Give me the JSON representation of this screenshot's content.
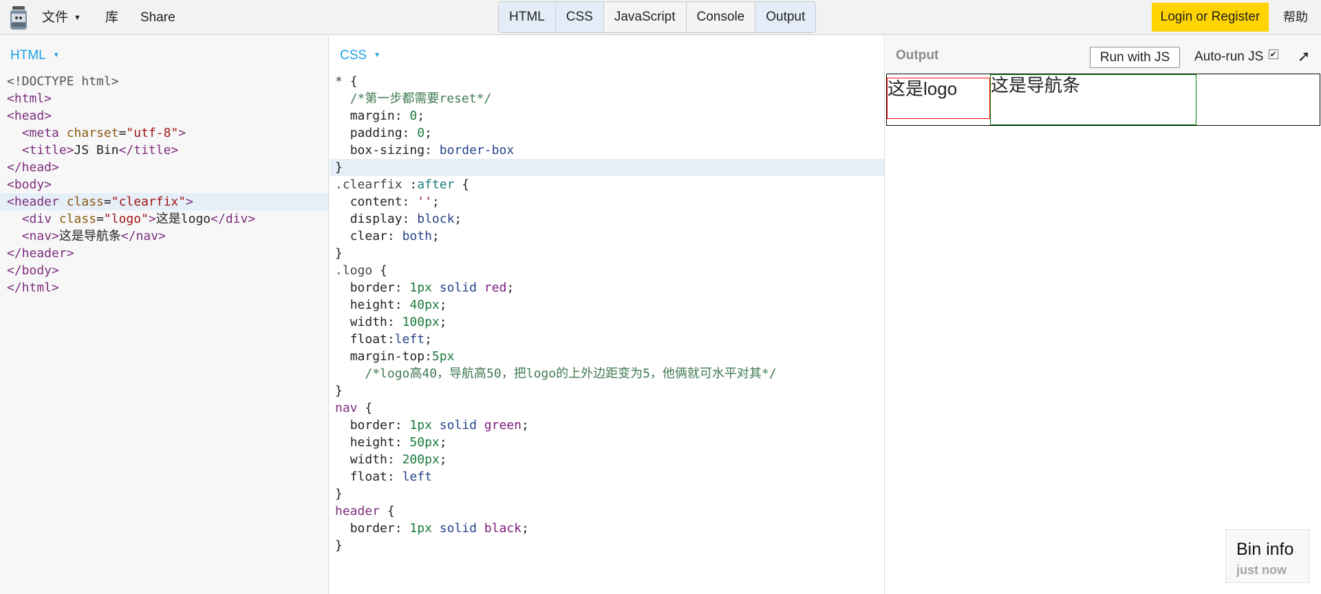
{
  "toolbar": {
    "menu_file": "文件",
    "menu_library": "库",
    "menu_share": "Share",
    "tabs": [
      "HTML",
      "CSS",
      "JavaScript",
      "Console",
      "Output"
    ],
    "active_tabs": [
      "HTML",
      "CSS",
      "Output"
    ],
    "login_label": "Login or Register",
    "help_label": "帮助",
    "accent_color": "#ffd400"
  },
  "html_panel": {
    "label": "HTML",
    "code": [
      {
        "doc": "<!DOCTYPE html>"
      },
      {
        "open": "<html>"
      },
      {
        "open": "<head>"
      },
      {
        "indent": "  ",
        "open": "<meta ",
        "attr": "charset",
        "eq": "=",
        "str": "\"utf-8\"",
        "close": ">"
      },
      {
        "indent": "  ",
        "open": "<title>",
        "text": "JS Bin",
        "close": "</title>"
      },
      {
        "open": "</head>"
      },
      {
        "open": "<body>"
      },
      {
        "open": "<header ",
        "attr": "class",
        "eq": "=",
        "str": "\"clearfix\"",
        "close": ">"
      },
      {
        "indent": "  ",
        "open": "<div ",
        "attr": "class",
        "eq": "=",
        "str": "\"logo\"",
        "close": ">",
        "text": "这是logo",
        "end": "</div>"
      },
      {
        "indent": "  ",
        "open": "<nav>",
        "text": "这是导航条",
        "end": "</nav>"
      },
      {
        "open": "</header>"
      },
      {
        "open": "</body>"
      },
      {
        "open": "</html>"
      }
    ]
  },
  "css_panel": {
    "label": "CSS",
    "lines": [
      "* {",
      "  /*第一步都需要reset*/",
      "  margin: 0;",
      "  padding: 0;",
      "  box-sizing: border-box",
      "}",
      ".clearfix:after {",
      "  content: '';",
      "  display: block;",
      "  clear: both;",
      "}",
      ".logo {",
      "  border: 1px solid red;",
      "  height: 40px;",
      "  width: 100px;",
      "  float:left;",
      "  margin-top:5px",
      "    /*logo高40，导航高50，把logo的上外边距变为5，他俩就可水平对其*/",
      "}",
      "nav {",
      "  border: 1px solid green;",
      "  height: 50px;",
      "  width: 200px;",
      "  float: left",
      "}",
      "header {",
      "  border: 1px solid black;",
      "}"
    ]
  },
  "output_panel": {
    "label": "Output",
    "run_button": "Run with JS",
    "autorun_label": "Auto-run JS",
    "autorun_checked": true,
    "demo_logo_text": "这是logo",
    "demo_nav_text": "这是导航条"
  },
  "bin_info": {
    "title": "Bin info",
    "time": "just now"
  }
}
